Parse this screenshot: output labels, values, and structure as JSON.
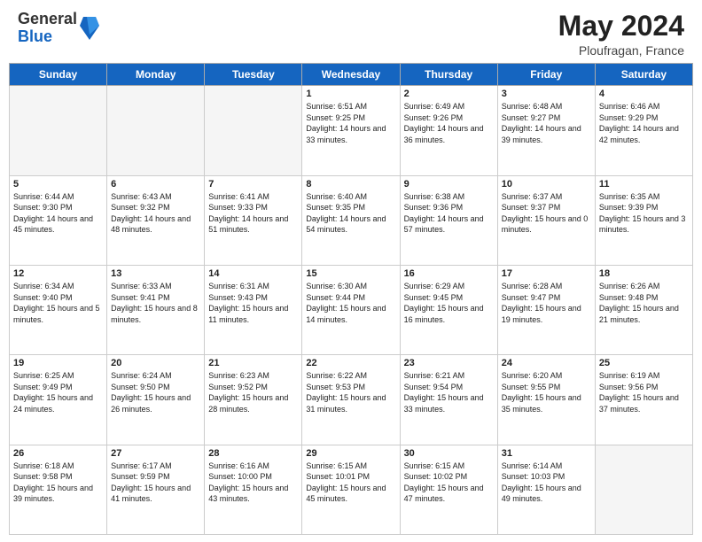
{
  "header": {
    "logo_general": "General",
    "logo_blue": "Blue",
    "month_title": "May 2024",
    "location": "Ploufragan, France"
  },
  "days_of_week": [
    "Sunday",
    "Monday",
    "Tuesday",
    "Wednesday",
    "Thursday",
    "Friday",
    "Saturday"
  ],
  "weeks": [
    [
      {
        "day": "",
        "info": "",
        "empty": true
      },
      {
        "day": "",
        "info": "",
        "empty": true
      },
      {
        "day": "",
        "info": "",
        "empty": true
      },
      {
        "day": "1",
        "info": "Sunrise: 6:51 AM\nSunset: 9:25 PM\nDaylight: 14 hours and 33 minutes.",
        "empty": false
      },
      {
        "day": "2",
        "info": "Sunrise: 6:49 AM\nSunset: 9:26 PM\nDaylight: 14 hours and 36 minutes.",
        "empty": false
      },
      {
        "day": "3",
        "info": "Sunrise: 6:48 AM\nSunset: 9:27 PM\nDaylight: 14 hours and 39 minutes.",
        "empty": false
      },
      {
        "day": "4",
        "info": "Sunrise: 6:46 AM\nSunset: 9:29 PM\nDaylight: 14 hours and 42 minutes.",
        "empty": false
      }
    ],
    [
      {
        "day": "5",
        "info": "Sunrise: 6:44 AM\nSunset: 9:30 PM\nDaylight: 14 hours and 45 minutes.",
        "empty": false
      },
      {
        "day": "6",
        "info": "Sunrise: 6:43 AM\nSunset: 9:32 PM\nDaylight: 14 hours and 48 minutes.",
        "empty": false
      },
      {
        "day": "7",
        "info": "Sunrise: 6:41 AM\nSunset: 9:33 PM\nDaylight: 14 hours and 51 minutes.",
        "empty": false
      },
      {
        "day": "8",
        "info": "Sunrise: 6:40 AM\nSunset: 9:35 PM\nDaylight: 14 hours and 54 minutes.",
        "empty": false
      },
      {
        "day": "9",
        "info": "Sunrise: 6:38 AM\nSunset: 9:36 PM\nDaylight: 14 hours and 57 minutes.",
        "empty": false
      },
      {
        "day": "10",
        "info": "Sunrise: 6:37 AM\nSunset: 9:37 PM\nDaylight: 15 hours and 0 minutes.",
        "empty": false
      },
      {
        "day": "11",
        "info": "Sunrise: 6:35 AM\nSunset: 9:39 PM\nDaylight: 15 hours and 3 minutes.",
        "empty": false
      }
    ],
    [
      {
        "day": "12",
        "info": "Sunrise: 6:34 AM\nSunset: 9:40 PM\nDaylight: 15 hours and 5 minutes.",
        "empty": false
      },
      {
        "day": "13",
        "info": "Sunrise: 6:33 AM\nSunset: 9:41 PM\nDaylight: 15 hours and 8 minutes.",
        "empty": false
      },
      {
        "day": "14",
        "info": "Sunrise: 6:31 AM\nSunset: 9:43 PM\nDaylight: 15 hours and 11 minutes.",
        "empty": false
      },
      {
        "day": "15",
        "info": "Sunrise: 6:30 AM\nSunset: 9:44 PM\nDaylight: 15 hours and 14 minutes.",
        "empty": false
      },
      {
        "day": "16",
        "info": "Sunrise: 6:29 AM\nSunset: 9:45 PM\nDaylight: 15 hours and 16 minutes.",
        "empty": false
      },
      {
        "day": "17",
        "info": "Sunrise: 6:28 AM\nSunset: 9:47 PM\nDaylight: 15 hours and 19 minutes.",
        "empty": false
      },
      {
        "day": "18",
        "info": "Sunrise: 6:26 AM\nSunset: 9:48 PM\nDaylight: 15 hours and 21 minutes.",
        "empty": false
      }
    ],
    [
      {
        "day": "19",
        "info": "Sunrise: 6:25 AM\nSunset: 9:49 PM\nDaylight: 15 hours and 24 minutes.",
        "empty": false
      },
      {
        "day": "20",
        "info": "Sunrise: 6:24 AM\nSunset: 9:50 PM\nDaylight: 15 hours and 26 minutes.",
        "empty": false
      },
      {
        "day": "21",
        "info": "Sunrise: 6:23 AM\nSunset: 9:52 PM\nDaylight: 15 hours and 28 minutes.",
        "empty": false
      },
      {
        "day": "22",
        "info": "Sunrise: 6:22 AM\nSunset: 9:53 PM\nDaylight: 15 hours and 31 minutes.",
        "empty": false
      },
      {
        "day": "23",
        "info": "Sunrise: 6:21 AM\nSunset: 9:54 PM\nDaylight: 15 hours and 33 minutes.",
        "empty": false
      },
      {
        "day": "24",
        "info": "Sunrise: 6:20 AM\nSunset: 9:55 PM\nDaylight: 15 hours and 35 minutes.",
        "empty": false
      },
      {
        "day": "25",
        "info": "Sunrise: 6:19 AM\nSunset: 9:56 PM\nDaylight: 15 hours and 37 minutes.",
        "empty": false
      }
    ],
    [
      {
        "day": "26",
        "info": "Sunrise: 6:18 AM\nSunset: 9:58 PM\nDaylight: 15 hours and 39 minutes.",
        "empty": false
      },
      {
        "day": "27",
        "info": "Sunrise: 6:17 AM\nSunset: 9:59 PM\nDaylight: 15 hours and 41 minutes.",
        "empty": false
      },
      {
        "day": "28",
        "info": "Sunrise: 6:16 AM\nSunset: 10:00 PM\nDaylight: 15 hours and 43 minutes.",
        "empty": false
      },
      {
        "day": "29",
        "info": "Sunrise: 6:15 AM\nSunset: 10:01 PM\nDaylight: 15 hours and 45 minutes.",
        "empty": false
      },
      {
        "day": "30",
        "info": "Sunrise: 6:15 AM\nSunset: 10:02 PM\nDaylight: 15 hours and 47 minutes.",
        "empty": false
      },
      {
        "day": "31",
        "info": "Sunrise: 6:14 AM\nSunset: 10:03 PM\nDaylight: 15 hours and 49 minutes.",
        "empty": false
      },
      {
        "day": "",
        "info": "",
        "empty": true
      }
    ]
  ]
}
